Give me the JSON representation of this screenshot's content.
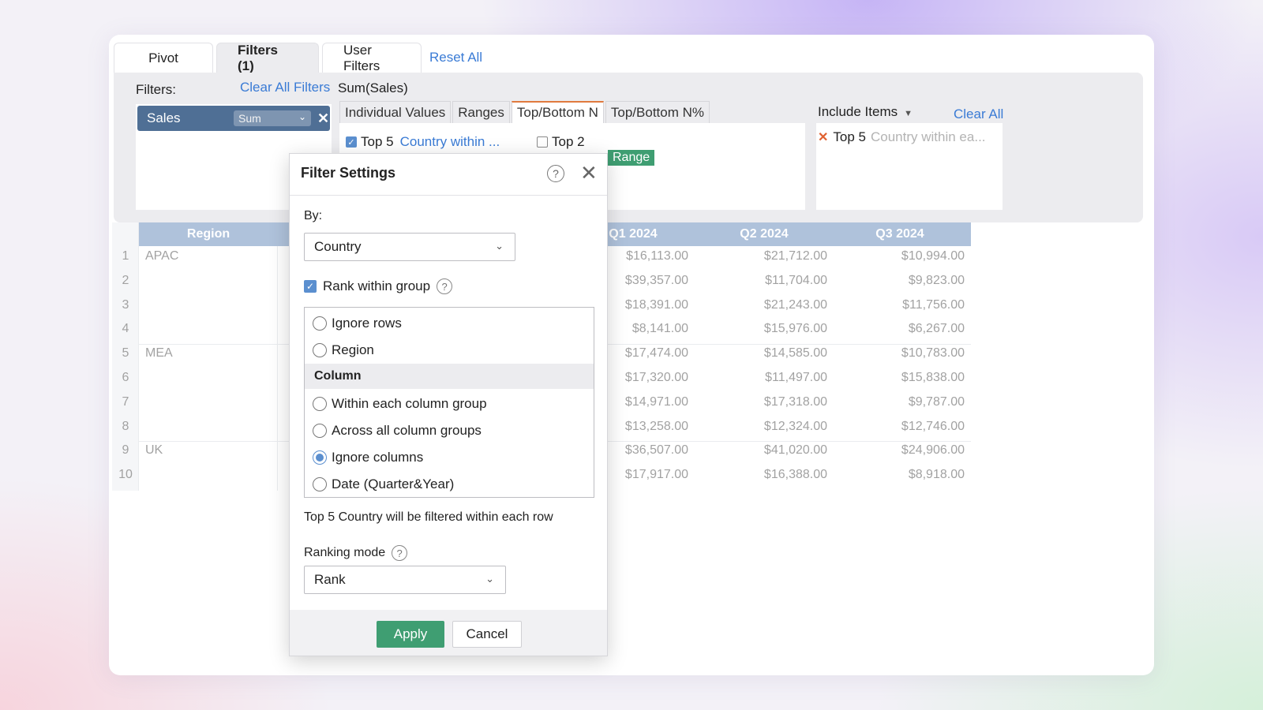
{
  "tabs": {
    "pivot": "Pivot",
    "filters": "Filters  (1)",
    "user_filters": "User Filters",
    "reset_all": "Reset All"
  },
  "filter_panel": {
    "label": "Filters:",
    "clear_all_filters": "Clear All Filters",
    "field_title": "Sum(Sales)",
    "chip": {
      "label": "Sales",
      "aggregate": "Sum"
    },
    "subtabs": [
      "Individual Values",
      "Ranges",
      "Top/Bottom N",
      "Top/Bottom N%"
    ],
    "active_subtab": "Top/Bottom N",
    "rule1": {
      "label": "Top 5",
      "link": "Country within ...",
      "checked": true
    },
    "rule2": {
      "label": "Top 2",
      "checked": false
    },
    "range_badge": "Range",
    "include_items": "Include Items",
    "clear_all": "Clear All",
    "included": {
      "label": "Top 5",
      "detail": "Country within ea..."
    }
  },
  "grid": {
    "headers": {
      "region": "Region",
      "q1": "Q1 2024",
      "q2": "Q2 2024",
      "q3": "Q3 2024"
    },
    "rows": [
      {
        "num": "1",
        "region": "APAC",
        "q1": "$16,113.00",
        "q2": "$21,712.00",
        "q3": "$10,994.00"
      },
      {
        "num": "2",
        "region": "",
        "q1": "$39,357.00",
        "q2": "$11,704.00",
        "q3": "$9,823.00"
      },
      {
        "num": "3",
        "region": "",
        "q1": "$18,391.00",
        "q2": "$21,243.00",
        "q3": "$11,756.00"
      },
      {
        "num": "4",
        "region": "",
        "q1": "$8,141.00",
        "q2": "$15,976.00",
        "q3": "$6,267.00"
      },
      {
        "num": "5",
        "region": "MEA",
        "q1": "$17,474.00",
        "q2": "$14,585.00",
        "q3": "$10,783.00"
      },
      {
        "num": "6",
        "region": "",
        "q1": "$17,320.00",
        "q2": "$11,497.00",
        "q3": "$15,838.00"
      },
      {
        "num": "7",
        "region": "",
        "q1": "$14,971.00",
        "q2": "$17,318.00",
        "q3": "$9,787.00"
      },
      {
        "num": "8",
        "region": "",
        "q1": "$13,258.00",
        "q2": "$12,324.00",
        "q3": "$12,746.00"
      },
      {
        "num": "9",
        "region": "UK",
        "q1": "$36,507.00",
        "q2": "$41,020.00",
        "q3": "$24,906.00"
      },
      {
        "num": "10",
        "region": "",
        "q1": "$17,917.00",
        "q2": "$16,388.00",
        "q3": "$8,918.00"
      }
    ]
  },
  "dialog": {
    "title": "Filter Settings",
    "by_label": "By:",
    "by_value": "Country",
    "rank_within_group": "Rank within group",
    "rank_within_group_checked": true,
    "options": {
      "ignore_rows": "Ignore rows",
      "region": "Region",
      "column_header": "Column",
      "within_each": "Within each column group",
      "across_all": "Across all column groups",
      "ignore_columns": "Ignore columns",
      "date": "Date (Quarter&Year)"
    },
    "selected_option": "Ignore columns",
    "note": "Top 5 Country will be filtered within each row",
    "ranking_mode_label": "Ranking mode",
    "ranking_mode_value": "Rank",
    "apply": "Apply",
    "cancel": "Cancel",
    "help_glyph": "?",
    "close_glyph": "✕"
  },
  "colors": {
    "accent_blue": "#3a7bd5",
    "chip_bg": "#4f6f95",
    "apply_green": "#3f9e72",
    "active_tab_border": "#e07a3e",
    "grid_header": "#6f91bf"
  }
}
